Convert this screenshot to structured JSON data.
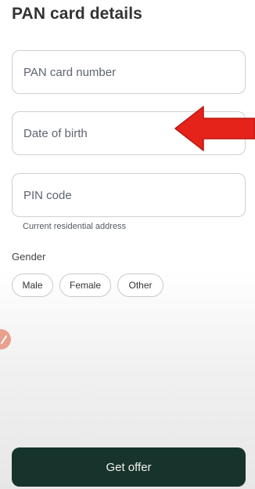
{
  "header": {
    "title": "PAN card details"
  },
  "form": {
    "pan": {
      "placeholder": "PAN card number",
      "value": ""
    },
    "dob": {
      "placeholder": "Date of birth",
      "value": ""
    },
    "pin": {
      "placeholder": "PIN code",
      "value": "",
      "helper": "Current residential address"
    }
  },
  "gender": {
    "label": "Gender",
    "options": [
      "Male",
      "Female",
      "Other"
    ]
  },
  "cta": {
    "label": "Get offer"
  },
  "colors": {
    "primary_button": "#16342b",
    "annotation_arrow": "#e5231b"
  },
  "icons": {
    "annotation": "red-arrow-icon",
    "edge_badge": "pencil-icon"
  }
}
